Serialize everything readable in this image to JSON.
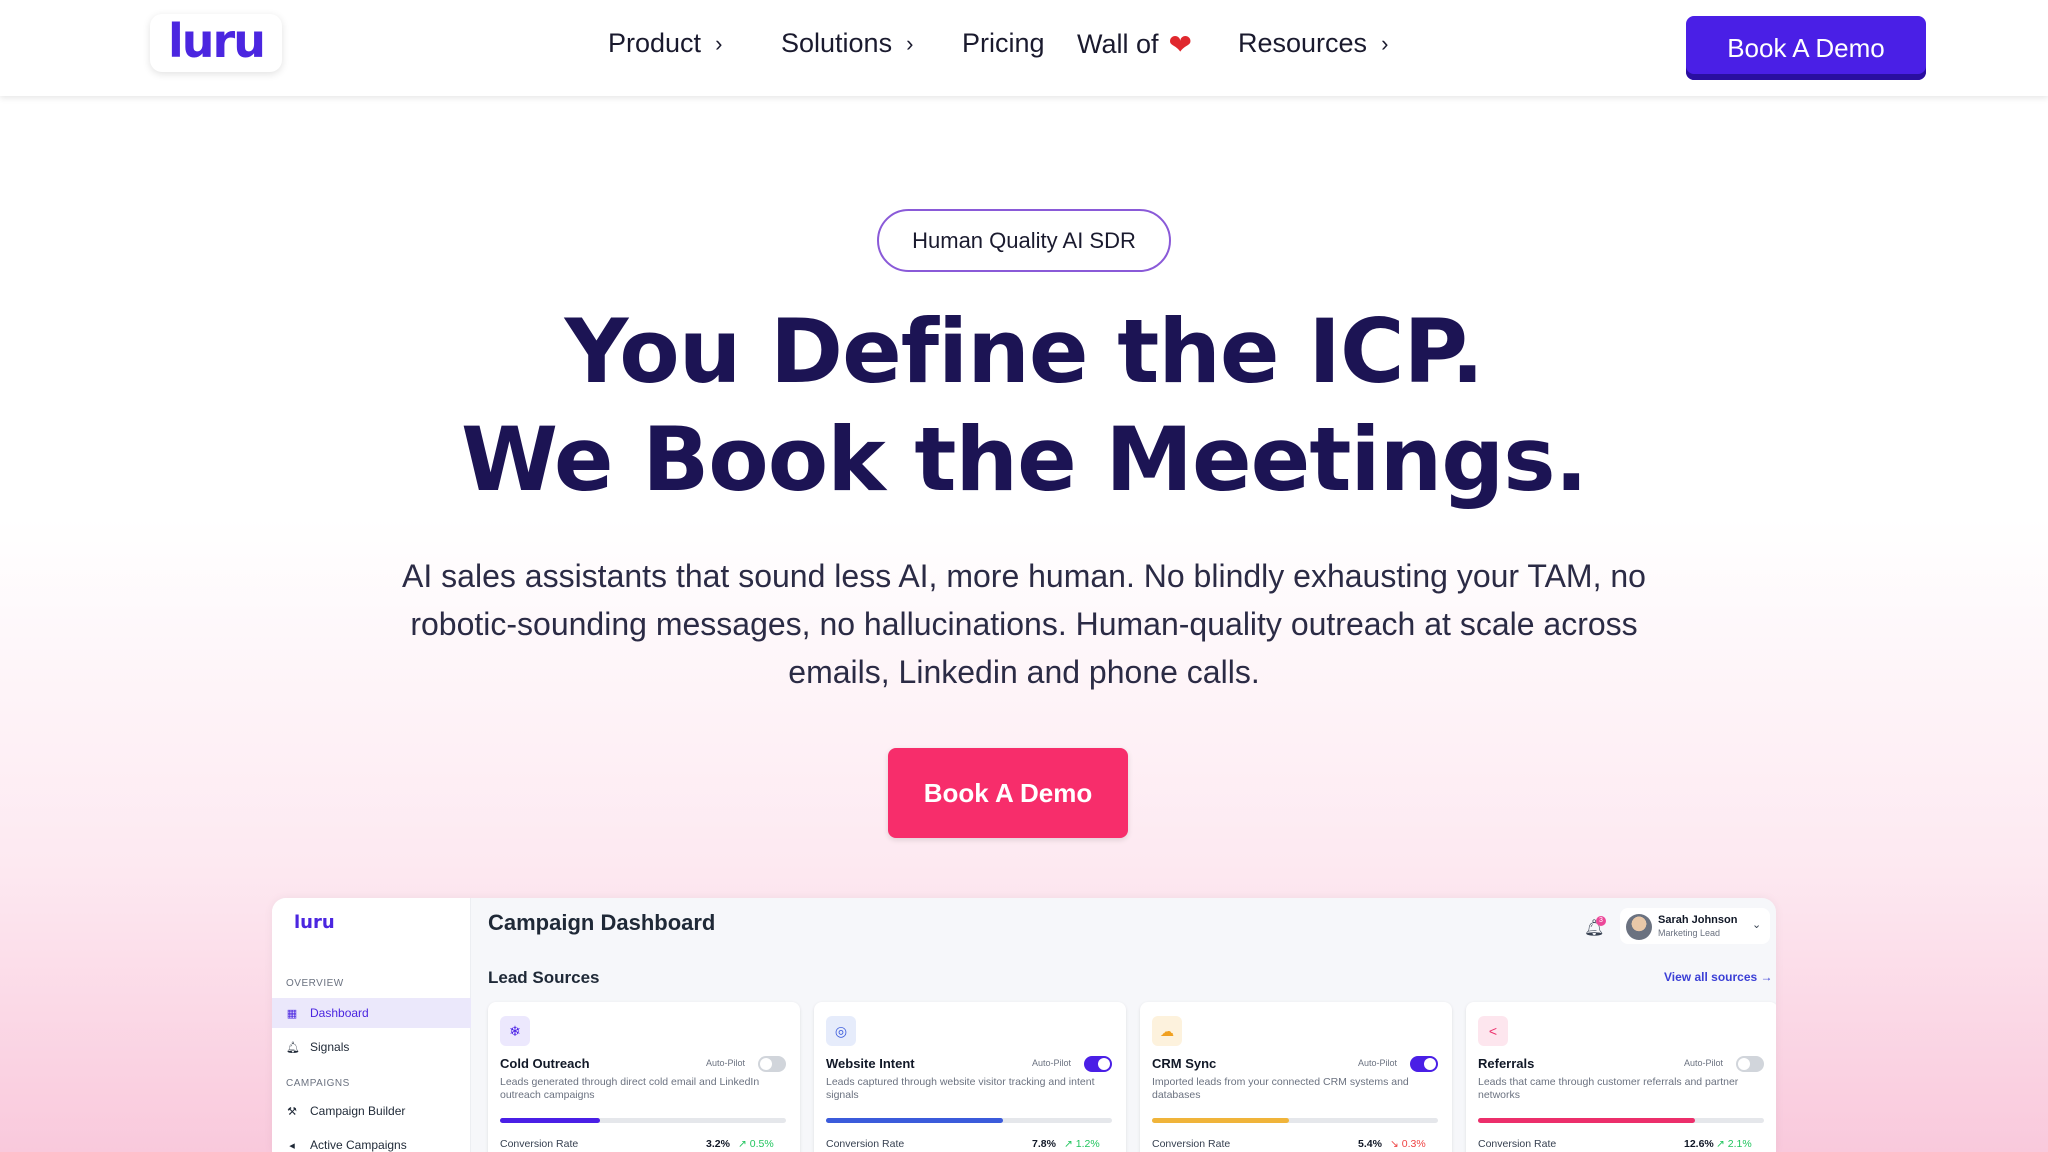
{
  "nav": {
    "logo": "luru",
    "items": [
      {
        "label": "Product",
        "has_chevron": true
      },
      {
        "label": "Solutions",
        "has_chevron": true
      },
      {
        "label": "Pricing",
        "has_chevron": false
      },
      {
        "label": "Wall of",
        "has_chevron": false
      },
      {
        "label": "Resources",
        "has_chevron": true
      }
    ],
    "heart_icon": "❤",
    "cta": "Book A Demo"
  },
  "hero": {
    "badge": "Human Quality AI SDR",
    "title_line1": "You Define the ICP.",
    "title_line2": "We Book the Meetings.",
    "subtitle": "AI sales assistants that sound less AI, more human. No blindly exhausting your TAM, no robotic-sounding messages, no hallucinations. Human-quality  outreach at scale across emails, Linkedin and phone calls.",
    "cta": "Book A Demo"
  },
  "dashboard": {
    "logo": "luru",
    "title": "Campaign Dashboard",
    "notification_count": "3",
    "user": {
      "name": "Sarah Johnson",
      "role": "Marketing Lead"
    },
    "sidebar": {
      "overview_label": "OVERVIEW",
      "campaigns_label": "CAMPAIGNS",
      "items": [
        "Dashboard",
        "Signals",
        "Campaign Builder",
        "Active Campaigns"
      ]
    },
    "lead_sources_title": "Lead Sources",
    "view_all": "View all sources →",
    "cards": [
      {
        "name": "Cold Outreach",
        "auto_label": "Auto-Pilot",
        "auto_on": false,
        "desc": "Leads generated through direct cold email and LinkedIn outreach campaigns",
        "progress": 0.35,
        "bar_color": "#4a1fe6",
        "icon": "❄",
        "icon_color": "#4a1fe6",
        "icon_bg": "#ece8fd",
        "conv_label": "Conversion Rate",
        "conv": "3.2%",
        "delta": "0.5%",
        "delta_up": true
      },
      {
        "name": "Website Intent",
        "auto_label": "Auto-Pilot",
        "auto_on": true,
        "desc": "Leads captured through website visitor tracking and intent signals",
        "progress": 0.62,
        "bar_color": "#3b5bdb",
        "icon": "◎",
        "icon_color": "#3b5bdb",
        "icon_bg": "#e6ecfb",
        "conv_label": "Conversion Rate",
        "conv": "7.8%",
        "delta": "1.2%",
        "delta_up": true
      },
      {
        "name": "CRM Sync",
        "auto_label": "Auto-Pilot",
        "auto_on": true,
        "desc": "Imported leads from your connected CRM systems and databases",
        "progress": 0.48,
        "bar_color": "#f0b43a",
        "icon": "☁",
        "icon_color": "#f0a020",
        "icon_bg": "#fdf2dd",
        "conv_label": "Conversion Rate",
        "conv": "5.4%",
        "delta": "0.3%",
        "delta_up": false
      },
      {
        "name": "Referrals",
        "auto_label": "Auto-Pilot",
        "auto_on": false,
        "desc": "Leads that came through customer referrals and partner networks",
        "progress": 0.76,
        "bar_color": "#ec2f6b",
        "icon": "<",
        "icon_color": "#ec2f6b",
        "icon_bg": "#fde6ee",
        "conv_label": "Conversion Rate",
        "conv": "12.6%",
        "delta": "2.1%",
        "delta_up": true
      }
    ]
  },
  "colors": {
    "brand": "#4a1fe6",
    "cta_pink": "#f72d6b",
    "heading": "#1c1454"
  }
}
